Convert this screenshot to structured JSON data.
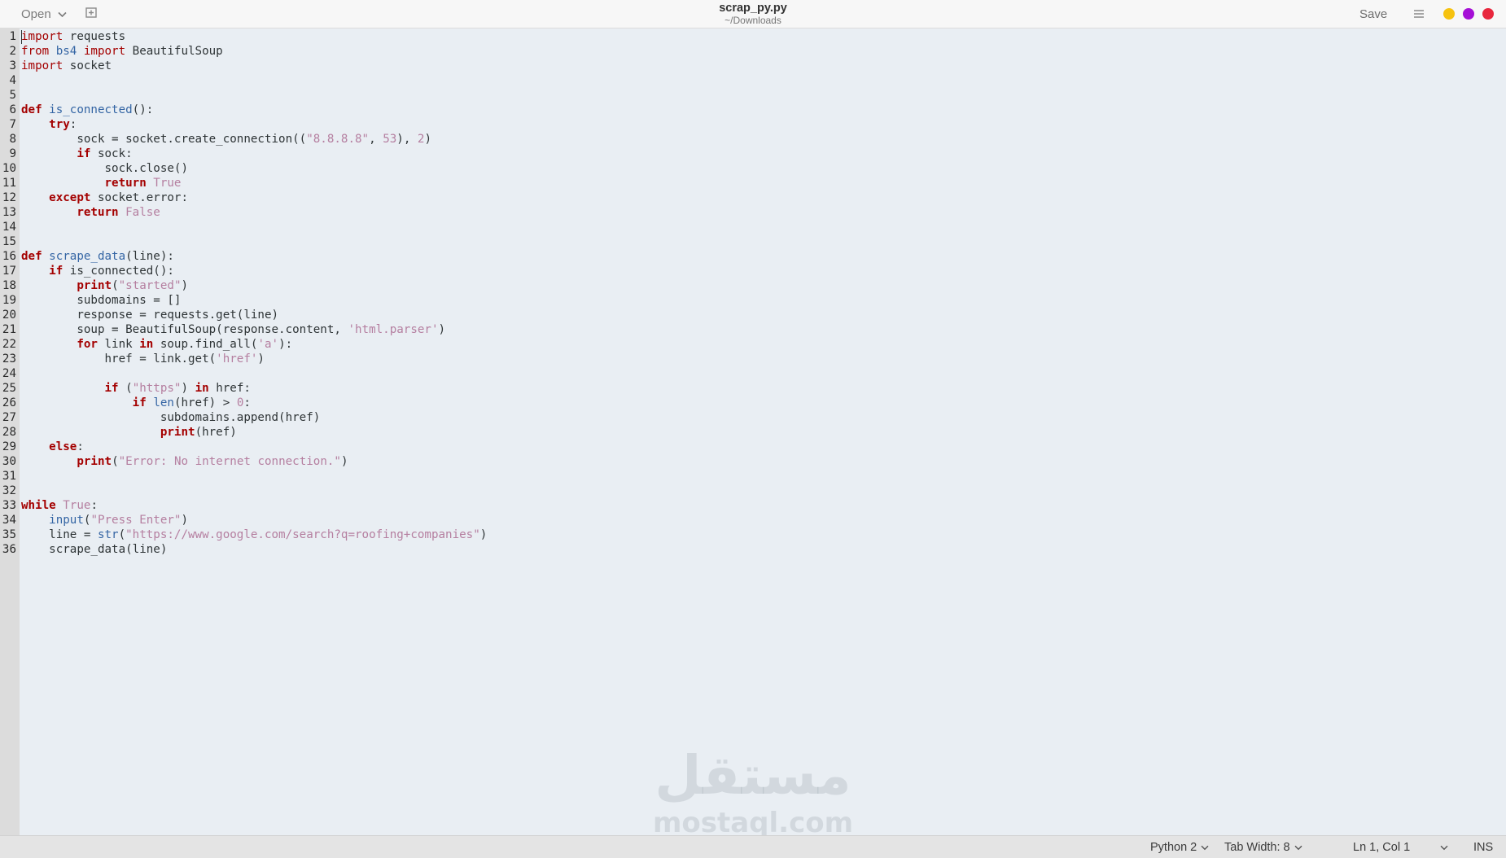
{
  "header": {
    "open_label": "Open",
    "title": "scrap_py.py",
    "subtitle": "~/Downloads",
    "save_label": "Save",
    "window_controls": [
      {
        "name": "minimize",
        "color": "#f6c20f"
      },
      {
        "name": "maximize",
        "color": "#a50fd6"
      },
      {
        "name": "close",
        "color": "#e8273d"
      }
    ]
  },
  "editor": {
    "line_numbers": [
      "1",
      "2",
      "3",
      "4",
      "5",
      "6",
      "7",
      "8",
      "9",
      "10",
      "11",
      "12",
      "13",
      "14",
      "15",
      "16",
      "17",
      "18",
      "19",
      "20",
      "21",
      "22",
      "23",
      "24",
      "25",
      "26",
      "27",
      "28",
      "29",
      "30",
      "31",
      "32",
      "33",
      "34",
      "35",
      "36"
    ],
    "lines": [
      [
        {
          "t": "import",
          "c": "k-light"
        },
        {
          "t": " requests"
        }
      ],
      [
        {
          "t": "from",
          "c": "k-light"
        },
        {
          "t": " "
        },
        {
          "t": "bs4",
          "c": "f"
        },
        {
          "t": " "
        },
        {
          "t": "import",
          "c": "k-light"
        },
        {
          "t": " BeautifulSoup"
        }
      ],
      [
        {
          "t": "import",
          "c": "k-light"
        },
        {
          "t": " socket"
        }
      ],
      [],
      [],
      [
        {
          "t": "def",
          "c": "k"
        },
        {
          "t": " "
        },
        {
          "t": "is_connected",
          "c": "f"
        },
        {
          "t": "():"
        }
      ],
      [
        {
          "t": "    "
        },
        {
          "t": "try",
          "c": "k"
        },
        {
          "t": ":"
        }
      ],
      [
        {
          "t": "        sock = socket.create_connection(("
        },
        {
          "t": "\"8.8.8.8\"",
          "c": "s"
        },
        {
          "t": ", "
        },
        {
          "t": "53",
          "c": "c"
        },
        {
          "t": "), "
        },
        {
          "t": "2",
          "c": "c"
        },
        {
          "t": ")"
        }
      ],
      [
        {
          "t": "        "
        },
        {
          "t": "if",
          "c": "k"
        },
        {
          "t": " sock:"
        }
      ],
      [
        {
          "t": "            sock.close()"
        }
      ],
      [
        {
          "t": "            "
        },
        {
          "t": "return",
          "c": "k"
        },
        {
          "t": " "
        },
        {
          "t": "True",
          "c": "c"
        }
      ],
      [
        {
          "t": "    "
        },
        {
          "t": "except",
          "c": "k"
        },
        {
          "t": " socket.error:"
        }
      ],
      [
        {
          "t": "        "
        },
        {
          "t": "return",
          "c": "k"
        },
        {
          "t": " "
        },
        {
          "t": "False",
          "c": "c"
        }
      ],
      [],
      [],
      [
        {
          "t": "def",
          "c": "k"
        },
        {
          "t": " "
        },
        {
          "t": "scrape_data",
          "c": "f"
        },
        {
          "t": "(line):"
        }
      ],
      [
        {
          "t": "    "
        },
        {
          "t": "if",
          "c": "k"
        },
        {
          "t": " is_connected():"
        }
      ],
      [
        {
          "t": "        "
        },
        {
          "t": "print",
          "c": "k"
        },
        {
          "t": "("
        },
        {
          "t": "\"started\"",
          "c": "s"
        },
        {
          "t": ")"
        }
      ],
      [
        {
          "t": "        subdomains = []"
        }
      ],
      [
        {
          "t": "        response = requests.get(line)"
        }
      ],
      [
        {
          "t": "        soup = BeautifulSoup(response.content, "
        },
        {
          "t": "'html.parser'",
          "c": "s"
        },
        {
          "t": ")"
        }
      ],
      [
        {
          "t": "        "
        },
        {
          "t": "for",
          "c": "k"
        },
        {
          "t": " link "
        },
        {
          "t": "in",
          "c": "k"
        },
        {
          "t": " soup.find_all("
        },
        {
          "t": "'a'",
          "c": "s"
        },
        {
          "t": "):"
        }
      ],
      [
        {
          "t": "            href = link.get("
        },
        {
          "t": "'href'",
          "c": "s"
        },
        {
          "t": ")"
        }
      ],
      [],
      [
        {
          "t": "            "
        },
        {
          "t": "if",
          "c": "k"
        },
        {
          "t": " ("
        },
        {
          "t": "\"https\"",
          "c": "s"
        },
        {
          "t": ") "
        },
        {
          "t": "in",
          "c": "k"
        },
        {
          "t": " href:"
        }
      ],
      [
        {
          "t": "                "
        },
        {
          "t": "if",
          "c": "k"
        },
        {
          "t": " "
        },
        {
          "t": "len",
          "c": "f"
        },
        {
          "t": "(href) > "
        },
        {
          "t": "0",
          "c": "c"
        },
        {
          "t": ":"
        }
      ],
      [
        {
          "t": "                    subdomains.append(href)"
        }
      ],
      [
        {
          "t": "                    "
        },
        {
          "t": "print",
          "c": "k"
        },
        {
          "t": "(href)"
        }
      ],
      [
        {
          "t": "    "
        },
        {
          "t": "else",
          "c": "k"
        },
        {
          "t": ":"
        }
      ],
      [
        {
          "t": "        "
        },
        {
          "t": "print",
          "c": "k"
        },
        {
          "t": "("
        },
        {
          "t": "\"Error: No internet connection.\"",
          "c": "s"
        },
        {
          "t": ")"
        }
      ],
      [],
      [],
      [
        {
          "t": "while",
          "c": "k"
        },
        {
          "t": " "
        },
        {
          "t": "True",
          "c": "c"
        },
        {
          "t": ":"
        }
      ],
      [
        {
          "t": "    "
        },
        {
          "t": "input",
          "c": "f"
        },
        {
          "t": "("
        },
        {
          "t": "\"Press Enter\"",
          "c": "s"
        },
        {
          "t": ")"
        }
      ],
      [
        {
          "t": "    line = "
        },
        {
          "t": "str",
          "c": "f"
        },
        {
          "t": "("
        },
        {
          "t": "\"https://www.google.com/search?q=roofing+companies\"",
          "c": "s"
        },
        {
          "t": ")"
        }
      ],
      [
        {
          "t": "    scrape_data(line)"
        }
      ]
    ]
  },
  "watermark": {
    "arabic": "مستقل",
    "latin": "mostaql.com"
  },
  "statusbar": {
    "language": "Python 2",
    "tab_width": "Tab Width: 8",
    "position": "Ln 1, Col 1",
    "mode": "INS"
  }
}
